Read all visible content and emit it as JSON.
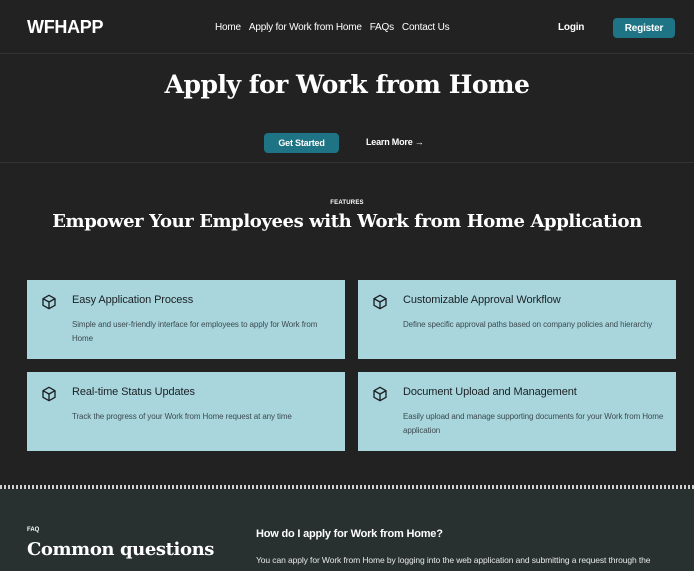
{
  "header": {
    "logo": "WFHAPP",
    "nav": [
      "Home",
      "Apply for Work from Home",
      "FAQs",
      "Contact Us"
    ],
    "login_label": "Login",
    "register_label": "Register"
  },
  "hero": {
    "title": "Apply for Work from Home",
    "get_started_label": "Get Started",
    "learn_more_label": "Learn More →"
  },
  "features": {
    "eyebrow": "FEATURES",
    "title": "Empower Your Employees with Work from Home Application",
    "cards": [
      {
        "title": "Easy Application Process",
        "description": "Simple and user-friendly interface for employees to apply for Work from Home",
        "icon": "cube-icon"
      },
      {
        "title": "Customizable Approval Workflow",
        "description": "Define specific approval paths based on company policies and hierarchy",
        "icon": "cube-icon"
      },
      {
        "title": "Real-time Status Updates",
        "description": "Track the progress of your Work from Home request at any time",
        "icon": "cube-icon"
      },
      {
        "title": "Document Upload and Management",
        "description": "Easily upload and manage supporting documents for your Work from Home application",
        "icon": "cube-icon"
      }
    ]
  },
  "faq": {
    "eyebrow": "FAQ",
    "title": "Common questions",
    "question": "How do I apply for Work from Home?",
    "answer": "You can apply for Work from Home by logging into the web application and submitting a request through the designated form."
  },
  "colors": {
    "background": "#222222",
    "accent": "#1e7484",
    "card": "#a8d6dc",
    "faq_background": "#283030"
  }
}
